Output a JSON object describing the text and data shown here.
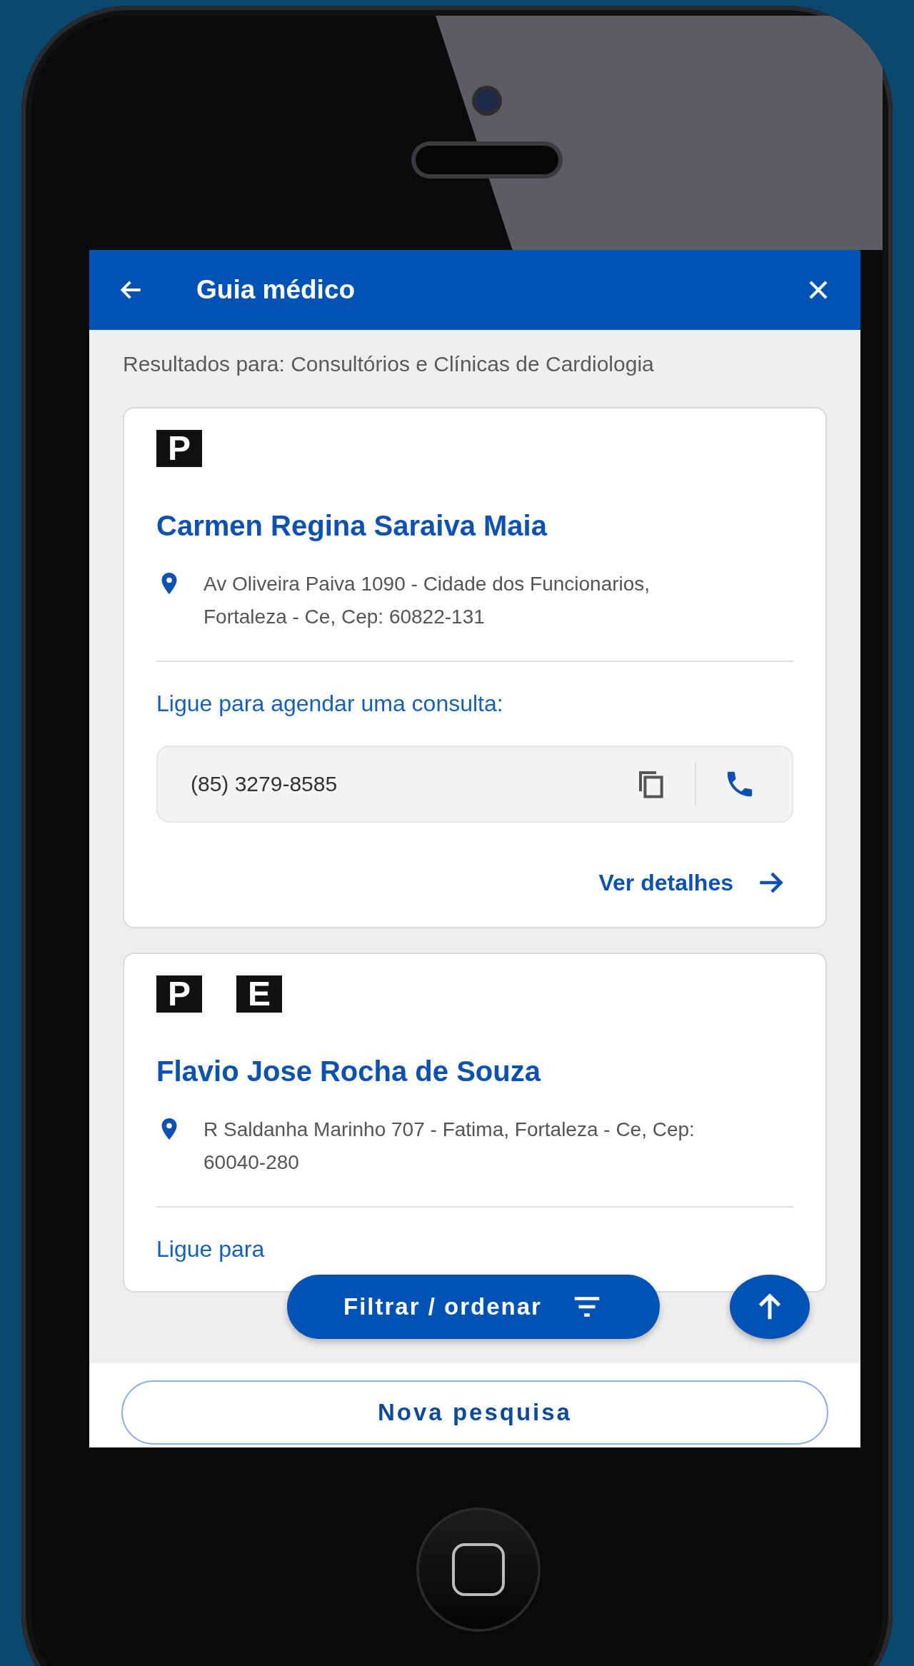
{
  "header": {
    "title": "Guia médico"
  },
  "results_label": "Resultados para: Consultórios e Clínicas de Cardiologia",
  "cards": [
    {
      "badges": [
        "P"
      ],
      "name": "Carmen Regina Saraiva Maia",
      "address": "Av Oliveira Paiva 1090 - Cidade dos Funcionarios, Fortaleza - Ce, Cep: 60822-131",
      "call_label": "Ligue para agendar uma consulta:",
      "phone": "(85) 3279-8585",
      "details_link": "Ver detalhes"
    },
    {
      "badges": [
        "P",
        "E"
      ],
      "name": "Flavio Jose Rocha de Souza",
      "address": "R Saldanha Marinho 707 - Fatima, Fortaleza - Ce, Cep: 60040-280",
      "call_label": "Ligue para"
    }
  ],
  "filter_button": "Filtrar / ordenar",
  "new_search_button": "Nova pesquisa"
}
